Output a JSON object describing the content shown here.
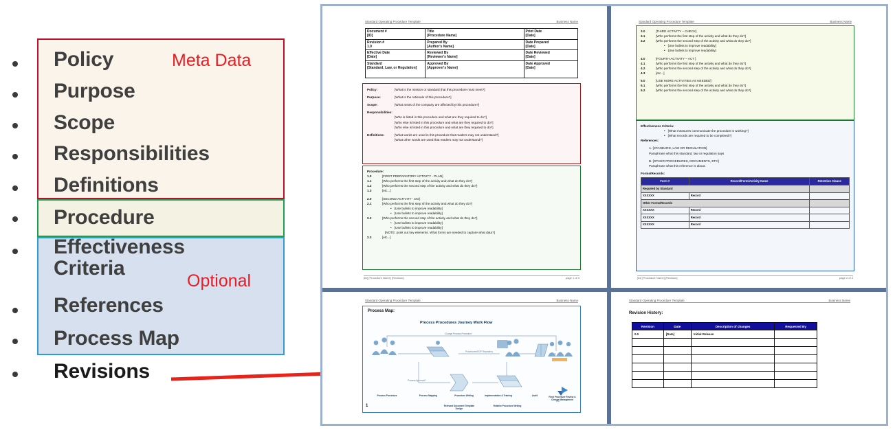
{
  "outline": {
    "items": [
      {
        "label": "Policy"
      },
      {
        "label": "Purpose"
      },
      {
        "label": "Scope"
      },
      {
        "label": "Responsibilities"
      },
      {
        "label": "Definitions"
      },
      {
        "label": "Procedure"
      },
      {
        "label": "Effectiveness Criteria"
      },
      {
        "label": "References"
      },
      {
        "label": "Process Map"
      },
      {
        "label": "Revisions"
      }
    ],
    "tags": {
      "meta": "Meta Data",
      "optional": "Optional"
    },
    "colors": {
      "meta_border": "#c00d2a",
      "meta_fill": "#fbf4ea",
      "procedure_border": "#1aa055",
      "procedure_fill": "#f4f2e3",
      "optional_border": "#2e9bd6",
      "optional_fill": "#d6e0ef",
      "tag_text": "#ed1c24",
      "arrow": "#e8231a"
    }
  },
  "pages": {
    "running_head_left": "Standard Operating Procedure Template",
    "running_head_right": "Business Name",
    "page1": {
      "footer_left": "[ID] [Procedure Name] [Revision]",
      "footer_right": "page 1 of 3",
      "meta_table": [
        {
          "c1_label": "Document #",
          "c1_value": "[ID]",
          "c2_label": "Title",
          "c2_value": "[Procedure Name]",
          "c3_label": "Print Date",
          "c3_value": "[Date]"
        },
        {
          "c1_label": "Revision #",
          "c1_value": "1.0",
          "c2_label": "Prepared By",
          "c2_value": "[Author's Name]",
          "c3_label": "Date Prepared",
          "c3_value": "[Date]"
        },
        {
          "c1_label": "Effective Date",
          "c1_value": "[Date]",
          "c2_label": "Reviewed By",
          "c2_value": "[Reviewer's Name]",
          "c3_label": "Date Reviewed",
          "c3_value": "[Date]"
        },
        {
          "c1_label": "Standard",
          "c1_value": "[Standard, Law, or Regulation]",
          "c2_label": "Approved By",
          "c2_value": "[Approver's Name]",
          "c3_label": "Date Approved",
          "c3_value": "[Date]"
        }
      ],
      "meta_section": {
        "policy_key": "Policy:",
        "policy_val": "[What is the mission or standard that this procedure must meet?]",
        "purpose_key": "Purpose:",
        "purpose_val": "[What is the rationale of this procedure?]",
        "scope_key": "Scope:",
        "scope_val": "[What areas of the company are affected by this procedure?]",
        "resp_key": "Responsibilities:",
        "resp_1": "[Who is listed in this procedure and what are they required to do?]",
        "resp_2": "[Who else is listed in this procedure and what are they required to do?]",
        "resp_3": "[Who else is listed in this procedure and what are they required to do?]",
        "def_key": "Definitions:",
        "def_1": "[What words are used in this procedure that readers may not understand?]",
        "def_2": "[What other words are used that readers may not understand?]"
      },
      "procedure_section": {
        "heading": "Procedure:",
        "lines": [
          {
            "num": "1.0",
            "text": "[FIRST PREPARATORY ACTIVITY - PLAN]",
            "style": "head"
          },
          {
            "num": "1.1",
            "text": "[Who performs the first step of the activity and what do they do?]",
            "style": "step"
          },
          {
            "num": "1.2",
            "text": "[Who performs the second step of the activity and what do they do?]",
            "style": "step"
          },
          {
            "num": "1.3",
            "text": "[etc...]",
            "style": "step"
          },
          {
            "num": "",
            "text": "",
            "style": "gap"
          },
          {
            "num": "2.0",
            "text": "[SECOND ACTIVITY - DO]",
            "style": "head"
          },
          {
            "num": "2.1",
            "text": "[Who performs the first step of the activity and what do they do?]",
            "style": "step"
          },
          {
            "num": "",
            "text": "[Use bullets to improve readability]",
            "style": "bullet"
          },
          {
            "num": "",
            "text": "[Use bullets to improve readability]",
            "style": "bullet"
          },
          {
            "num": "2.2",
            "text": "[Who performs the second step of the activity and what do they do?]",
            "style": "step"
          },
          {
            "num": "",
            "text": "[Use bullets to improve readability]",
            "style": "bullet"
          },
          {
            "num": "",
            "text": "[Use bullets to improve readability]",
            "style": "bullet"
          },
          {
            "num": "",
            "text": "[NOTE: point out key elements.  What forms are needed to capture what data?]",
            "style": "note"
          },
          {
            "num": "2.3",
            "text": "[etc...]",
            "style": "step"
          }
        ]
      }
    },
    "page2": {
      "footer_left": "[ID] [Procedure Name] [Revision]",
      "footer_right": "page 2 of 3",
      "procedure_cont": [
        {
          "num": "3.0",
          "text": "[THIRD ACTIVITY – CHECK]",
          "style": "head"
        },
        {
          "num": "3.1",
          "text": "[Who performs the first step of the activity and what do they do?]",
          "style": "step"
        },
        {
          "num": "3.2",
          "text": "[Who performs the second step of the activity and what do they do?]",
          "style": "step"
        },
        {
          "num": "",
          "text": "[Use bullets to improve readability]",
          "style": "bullet"
        },
        {
          "num": "",
          "text": "[Use bullets to improve readability]",
          "style": "bullet"
        },
        {
          "num": "",
          "text": "",
          "style": "gap"
        },
        {
          "num": "4.0",
          "text": "[FOURTH ACTIVITY – ACT ]",
          "style": "head"
        },
        {
          "num": "4.1",
          "text": "[Who performs the first step of the activity and what do they do?]",
          "style": "step"
        },
        {
          "num": "4.2",
          "text": "[Who performs the second step of the activity and what do they do?]",
          "style": "step"
        },
        {
          "num": "4.3",
          "text": "[etc...]",
          "style": "step"
        },
        {
          "num": "",
          "text": "",
          "style": "gap"
        },
        {
          "num": "5.0",
          "text": "[USE MORE ACTIVITIES AS NEEDED]",
          "style": "head"
        },
        {
          "num": "5.1",
          "text": "[Who performs the first step of the activity and what do they do?]",
          "style": "step"
        },
        {
          "num": "5.2",
          "text": "[Who performs the second step of the activity and what do they do?]",
          "style": "step"
        }
      ],
      "effectiveness": {
        "heading": "Effectiveness Criteria:",
        "bullet_1": "[What measures communicate the procedure is working?]",
        "bullet_2": "[What records are required to be completed?]",
        "references_heading": "References:",
        "ref_a": "A.  [STANDARD, LAW OR REGULATION]",
        "ref_a_desc": "Paraphrase what this standard, law or regulation says",
        "ref_b": "B.  [OTHER PROCEDURES, DOCUMENTS, ETC]",
        "ref_b_desc": "Paraphrase what this reference is about.",
        "forms_heading": "Forms/Records:"
      },
      "forms_table": {
        "headers": [
          "Form #",
          "Record/Form/Activity  Name",
          "Retention Clause"
        ],
        "rows": [
          {
            "type": "section",
            "label": "Required by Standard"
          },
          {
            "type": "data",
            "cells": [
              "XXXXXX",
              "Record",
              ""
            ]
          },
          {
            "type": "section",
            "label": "Other Forms/Records"
          },
          {
            "type": "data",
            "cells": [
              "XXXXXX",
              "Record",
              ""
            ]
          },
          {
            "type": "data",
            "cells": [
              "XXXXXX",
              "Record",
              ""
            ]
          },
          {
            "type": "data",
            "cells": [
              "XXXXXX",
              "Record",
              ""
            ]
          }
        ]
      }
    },
    "page3": {
      "title": "Process Map:",
      "diagram_title": "Process Procedures Journey Work Flow",
      "nodes": [
        {
          "label": "Process Procedure"
        },
        {
          "label": "Process Mapping"
        },
        {
          "label": "Procedure Writing"
        },
        {
          "label": "Implementation & Training"
        },
        {
          "label": "Audit"
        },
        {
          "label": "Final Procedure Review & Change Management"
        },
        {
          "label": "Relevant Document Template Design"
        },
        {
          "label": "Relative Procedure Writing"
        }
      ],
      "edge_labels": [
        "Change Process Procedure",
        "Procedures/SOP Repository",
        "Process Approval?"
      ],
      "page_marker": "1"
    },
    "page4": {
      "heading": "Revision History:",
      "table": {
        "headers": [
          "Revision",
          "Date",
          "Description of changes",
          "Requested By"
        ],
        "rows": [
          [
            "0.0",
            "[Date]",
            "Initial Release",
            ""
          ],
          [
            "",
            "",
            "",
            ""
          ],
          [
            "",
            "",
            "",
            ""
          ],
          [
            "",
            "",
            "",
            ""
          ],
          [
            "",
            "",
            "",
            ""
          ],
          [
            "",
            "",
            "",
            ""
          ],
          [
            "",
            "",
            "",
            ""
          ]
        ]
      }
    }
  }
}
